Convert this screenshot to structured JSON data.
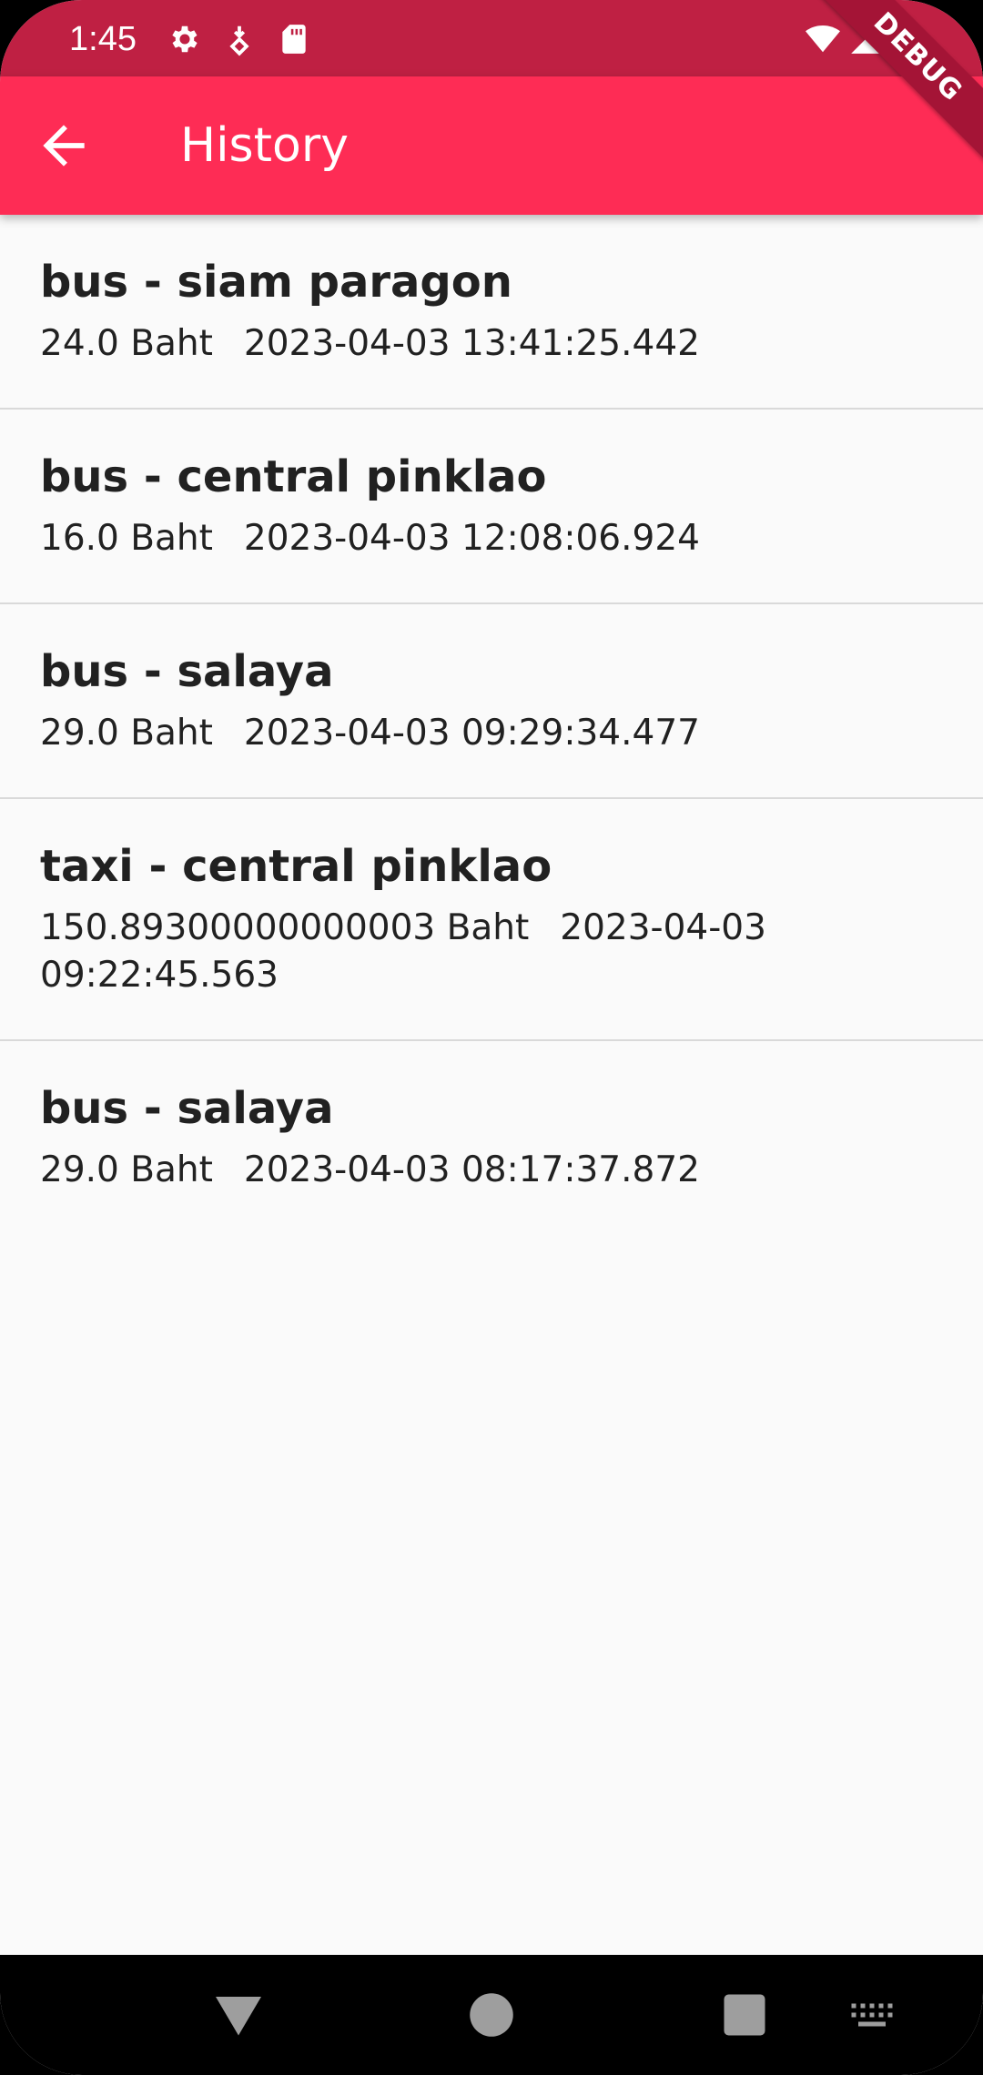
{
  "status_bar": {
    "time": "1:45",
    "icons": [
      "settings-icon",
      "download-icon",
      "sd-card-icon",
      "wifi-icon",
      "signal-icon",
      "battery-icon"
    ],
    "color": "#bf2043"
  },
  "debug_banner": {
    "label": "DEBUG"
  },
  "app_bar": {
    "title": "History",
    "back_icon": "arrow-back-icon",
    "color": "#fe2c55"
  },
  "history": {
    "items": [
      {
        "title": "bus - siam paragon",
        "price": "24.0 Baht",
        "datetime": "2023-04-03 13:41:25.442"
      },
      {
        "title": "bus - central pinklao",
        "price": "16.0 Baht",
        "datetime": "2023-04-03 12:08:06.924"
      },
      {
        "title": "bus - salaya",
        "price": "29.0 Baht",
        "datetime": "2023-04-03 09:29:34.477"
      },
      {
        "title": "taxi - central pinklao",
        "price": "150.89300000000003 Baht",
        "datetime": "2023-04-03 09:22:45.563"
      },
      {
        "title": "bus - salaya",
        "price": "29.0 Baht",
        "datetime": "2023-04-03 08:17:37.872"
      }
    ]
  },
  "nav_bar": {
    "buttons": [
      "back-triangle-icon",
      "home-circle-icon",
      "recents-square-icon",
      "keyboard-icon"
    ]
  }
}
